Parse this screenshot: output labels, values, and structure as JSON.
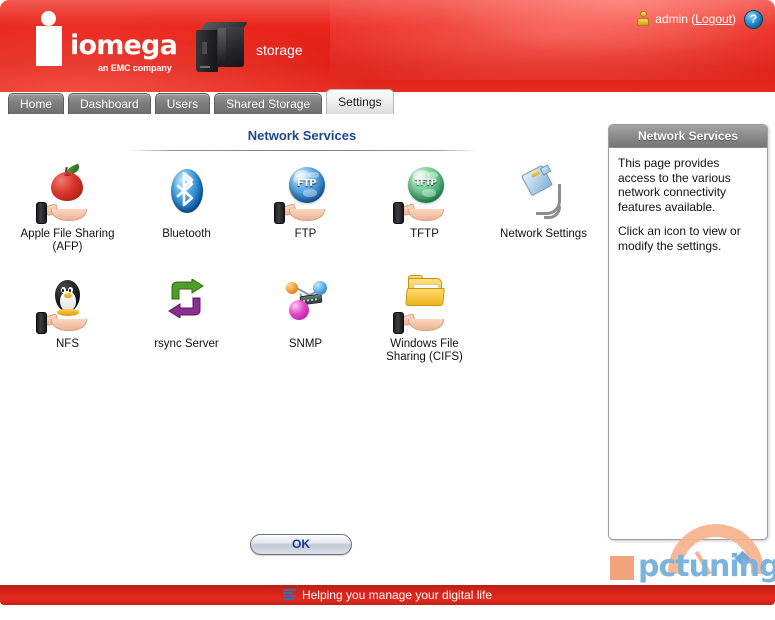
{
  "header": {
    "brand_name": "iomega",
    "brand_tagline": "an EMC company",
    "device_label": "storage",
    "user_label": "admin (",
    "logout_label": "Logout",
    "user_label_close": ")",
    "help_label": "?",
    "brand_red": "#e8241b"
  },
  "tabs": [
    {
      "label": "Home",
      "active": false
    },
    {
      "label": "Dashboard",
      "active": false
    },
    {
      "label": "Users",
      "active": false
    },
    {
      "label": "Shared Storage",
      "active": false
    },
    {
      "label": "Settings",
      "active": true
    }
  ],
  "main": {
    "page_title": "Network Services",
    "ok_label": "OK",
    "title_color": "#22458b",
    "icons": [
      {
        "label": "Apple File Sharing (AFP)",
        "icon": "apple-file-sharing-icon"
      },
      {
        "label": "Bluetooth",
        "icon": "bluetooth-icon"
      },
      {
        "label": "FTP",
        "icon": "ftp-globe-icon",
        "glyph": "FTP"
      },
      {
        "label": "TFTP",
        "icon": "tftp-globe-icon",
        "glyph": "TFTP"
      },
      {
        "label": "Network Settings",
        "icon": "network-plug-icon"
      },
      {
        "label": "NFS",
        "icon": "nfs-penguin-icon"
      },
      {
        "label": "rsync Server",
        "icon": "rsync-arrows-icon"
      },
      {
        "label": "SNMP",
        "icon": "snmp-nodes-icon"
      },
      {
        "label": "Windows File Sharing (CIFS)",
        "icon": "cifs-folder-icon"
      }
    ]
  },
  "sidebar": {
    "title": "Network Services",
    "paragraphs": [
      "This page provides access to the various network connectivity features available.",
      "Click an icon to view or modify the settings."
    ]
  },
  "watermark": {
    "text": "pctuning"
  },
  "footer": {
    "text": "Helping you manage your digital life"
  }
}
